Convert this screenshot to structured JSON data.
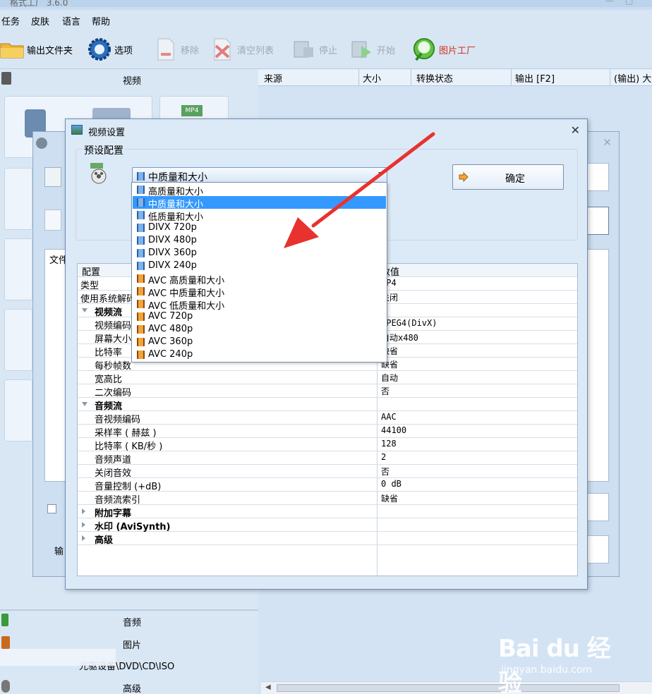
{
  "window": {
    "title": "格式工厂 3.6.0",
    "menu": [
      "任务",
      "皮肤",
      "语言",
      "帮助"
    ]
  },
  "toolbar": {
    "output_folder": "输出文件夹",
    "options": "选项",
    "remove": "移除",
    "clear_list": "清空列表",
    "stop": "停止",
    "start": "开始",
    "picture_factory": "图片工厂"
  },
  "left_panel": {
    "video_label": "视频",
    "audio_label": "音频",
    "picture_label": "图片",
    "rom_label": "光驱设备\\DVD\\CD\\ISO",
    "advanced_label": "高级",
    "tile_mp4_badge": "MP4"
  },
  "file_list": {
    "columns": [
      "来源",
      "大小",
      "转换状态",
      "输出 [F2]",
      "(输出) 大"
    ]
  },
  "bg_dialog": {
    "file_col": "文件",
    "output_label": "输"
  },
  "dialog": {
    "title": "视频设置",
    "preset_label": "预设配置",
    "selected_preset": "中质量和大小",
    "ok_label": "确定",
    "grid_header_key": "配置",
    "grid_header_value": "数值",
    "rows": [
      {
        "key": "类型",
        "value": "MP4",
        "level": 0,
        "type": "row"
      },
      {
        "key": "使用系统解码器",
        "value": "关闭",
        "level": 0,
        "type": "row"
      },
      {
        "key": "视频流",
        "value": "",
        "level": 0,
        "type": "section-open"
      },
      {
        "key": "视频编码",
        "value": "MPEG4(DivX)",
        "level": 1,
        "type": "row"
      },
      {
        "key": "屏幕大小",
        "value": "自动x480",
        "level": 1,
        "type": "row"
      },
      {
        "key": "比特率",
        "value": "缺省",
        "level": 1,
        "type": "row"
      },
      {
        "key": "每秒帧数",
        "value": "缺省",
        "level": 1,
        "type": "row"
      },
      {
        "key": "宽高比",
        "value": "自动",
        "level": 1,
        "type": "row"
      },
      {
        "key": "二次编码",
        "value": "否",
        "level": 1,
        "type": "row"
      },
      {
        "key": "音频流",
        "value": "",
        "level": 0,
        "type": "section-open"
      },
      {
        "key": "音视频编码",
        "value": "AAC",
        "level": 1,
        "type": "row"
      },
      {
        "key": "采样率 ( 赫兹 )",
        "value": "44100",
        "level": 1,
        "type": "row"
      },
      {
        "key": "比特率 ( KB/秒 )",
        "value": "128",
        "level": 1,
        "type": "row"
      },
      {
        "key": "音频声道",
        "value": "2",
        "level": 1,
        "type": "row"
      },
      {
        "key": "关闭音效",
        "value": "否",
        "level": 1,
        "type": "row"
      },
      {
        "key": "音量控制 (+dB)",
        "value": "0 dB",
        "level": 1,
        "type": "row"
      },
      {
        "key": "音频流索引",
        "value": "缺省",
        "level": 1,
        "type": "row"
      },
      {
        "key": "附加字幕",
        "value": "",
        "level": 0,
        "type": "section-closed"
      },
      {
        "key": "水印 (AviSynth)",
        "value": "",
        "level": 0,
        "type": "section-closed"
      },
      {
        "key": "高级",
        "value": "",
        "level": 0,
        "type": "section-closed"
      }
    ]
  },
  "dropdown": {
    "items": [
      {
        "label": "高质量和大小",
        "icon": "blue",
        "selected": false
      },
      {
        "label": "中质量和大小",
        "icon": "blue",
        "selected": true
      },
      {
        "label": "低质量和大小",
        "icon": "blue",
        "selected": false
      },
      {
        "label": "DIVX 720p",
        "icon": "blue",
        "selected": false
      },
      {
        "label": "DIVX 480p",
        "icon": "blue",
        "selected": false
      },
      {
        "label": "DIVX 360p",
        "icon": "blue",
        "selected": false
      },
      {
        "label": "DIVX 240p",
        "icon": "blue",
        "selected": false
      },
      {
        "label": "AVC 高质量和大小",
        "icon": "orange",
        "selected": false
      },
      {
        "label": "AVC 中质量和大小",
        "icon": "orange",
        "selected": false
      },
      {
        "label": "AVC 低质量和大小",
        "icon": "orange",
        "selected": false
      },
      {
        "label": "AVC 720p",
        "icon": "orange",
        "selected": false
      },
      {
        "label": "AVC 480p",
        "icon": "orange",
        "selected": false
      },
      {
        "label": "AVC 360p",
        "icon": "orange",
        "selected": false
      },
      {
        "label": "AVC 240p",
        "icon": "orange",
        "selected": false
      }
    ]
  },
  "watermark": {
    "brand": "Bai du 经验",
    "url": "jingyan.baidu.com"
  },
  "colors": {
    "selection": "#3399ff",
    "annotation_arrow": "#e8322f"
  }
}
